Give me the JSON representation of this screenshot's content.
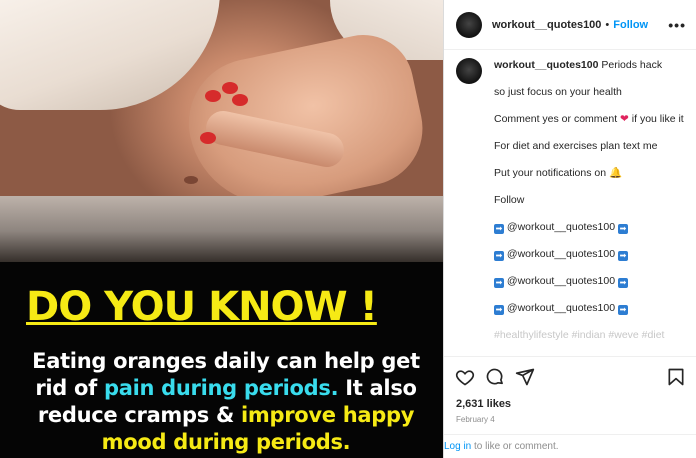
{
  "post_image": {
    "headline": "DO YOU KNOW !",
    "body_part1": "Eating oranges daily can help get rid of ",
    "body_highlight1": "pain during periods.",
    "body_part2": " It also reduce cramps & ",
    "body_highlight2": "improve happy mood during periods.",
    "colors": {
      "headline": "#f6ea15",
      "highlight_cyan": "#39dced",
      "text": "#ffffff",
      "background": "#050505"
    }
  },
  "header": {
    "username": "workout__quotes100",
    "separator": "•",
    "follow_label": "Follow",
    "more_label": "•••"
  },
  "caption": {
    "username": "workout__quotes100",
    "first_line": "Periods hack",
    "lines": [
      "so just focus on your health",
      "Comment yes or comment",
      "if you like it",
      "For diet and exercises plan text me",
      "Put your notifications on",
      "Follow"
    ],
    "mention": "@workout__quotes100",
    "hashtags_faded": "#healthylifestyle #indian #weve #diet"
  },
  "icons": {
    "like": "heart-outline-icon",
    "comment": "comment-bubble-icon",
    "share": "paper-plane-icon",
    "save": "bookmark-icon",
    "heart_emoji": "red-heart-emoji",
    "bell_emoji": "bell-emoji",
    "arrow": "right-arrow-emoji"
  },
  "stats": {
    "likes": "2,631 likes",
    "date": "February 4"
  },
  "login": {
    "link": "Log in",
    "text": " to like or comment."
  },
  "colors": {
    "accent": "#0095f6",
    "heart": "#e0245e",
    "arrow_box": "#2d7dd2"
  }
}
